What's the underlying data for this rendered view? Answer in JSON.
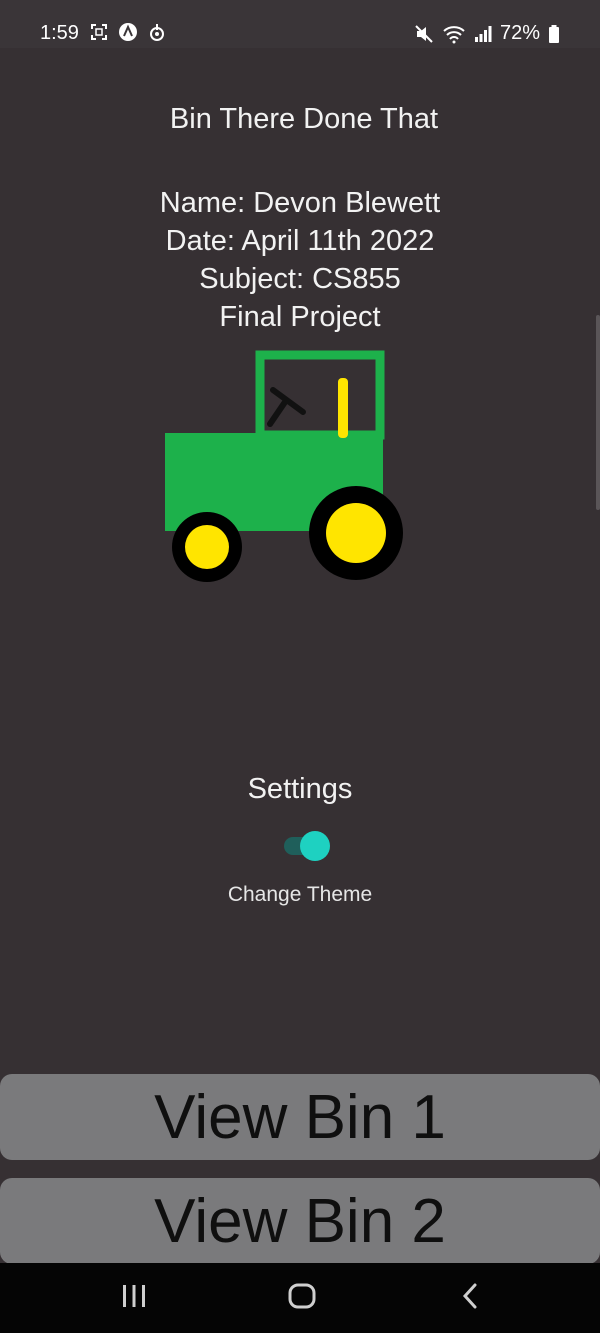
{
  "status": {
    "time": "1:59",
    "battery": "72%"
  },
  "app": {
    "title": "Bin There Done That"
  },
  "info": {
    "name": "Name: Devon Blewett",
    "date": "Date: April 11th 2022",
    "subject": "Subject: CS855",
    "project": "Final Project"
  },
  "settings": {
    "title": "Settings",
    "toggle_label": "Change Theme",
    "toggle_on": true
  },
  "buttons": {
    "bin1": "View Bin 1",
    "bin2": "View Bin 2"
  },
  "colors": {
    "background": "#363033",
    "tractor_green": "#1db14b",
    "wheel_yellow": "#ffe500",
    "toggle_accent": "#1ed1c1",
    "button_gray": "#7a7a7c"
  },
  "icons": {
    "status_left": [
      "screenshot-icon",
      "app-a-icon",
      "notification-icon"
    ],
    "status_right": [
      "mute-icon",
      "wifi-icon",
      "signal-icon",
      "battery-icon"
    ],
    "nav": [
      "recents-icon",
      "home-icon",
      "back-icon"
    ]
  }
}
